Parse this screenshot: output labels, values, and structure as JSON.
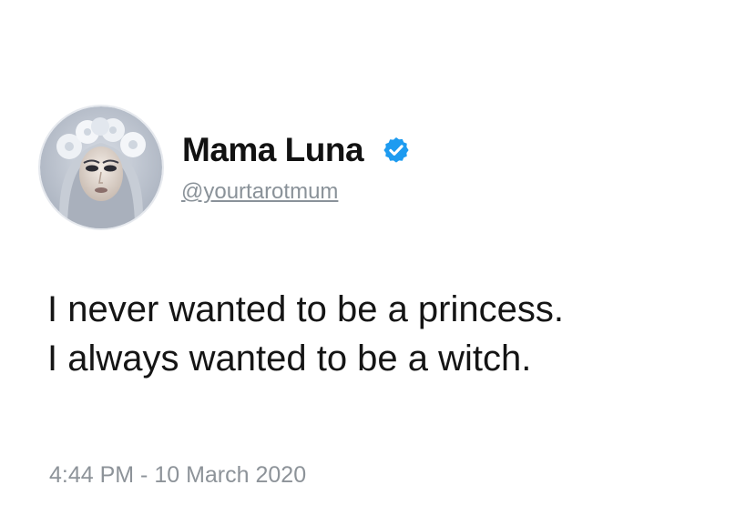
{
  "tweet": {
    "author": {
      "display_name": "Mama Luna",
      "handle": "@yourtarotmum",
      "verified": true,
      "verified_icon": "verified-badge-icon",
      "verified_color": "#1d9bf0"
    },
    "text_lines": [
      "I never wanted to be a princess.",
      "I always wanted to be a witch."
    ],
    "timestamp": "4:44 PM - 10 March 2020"
  }
}
